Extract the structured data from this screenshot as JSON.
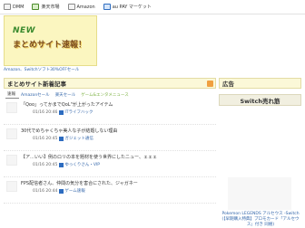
{
  "topbar": {
    "links": [
      {
        "label": "DMM",
        "icon": "page-icon"
      },
      {
        "label": "楽天市場",
        "icon": "rakuten-icon"
      },
      {
        "label": "Amazon",
        "icon": "page-icon"
      },
      {
        "label": "au PAY マーケット",
        "icon": "aupay-icon"
      }
    ]
  },
  "banner": {
    "new_label": "NEW",
    "title": "まとめサイト速報！"
  },
  "breadcrumb": "Amazon、Switchソフト30%OFFセール",
  "main": {
    "section_title": "まとめサイト新着記事",
    "tabs": [
      {
        "label": "速報"
      },
      {
        "label": "Amazonセール"
      },
      {
        "label": "楽天セール"
      },
      {
        "label": "ゲーム&エンタメニュース"
      }
    ],
    "articles": [
      {
        "title": "「Qoo」ってかまでQoL\"が上がったアイテム",
        "date": "01/16 20:46",
        "source": "ITライフハック"
      },
      {
        "title": "30代でめちゃくちゃ美人な子が結婚しない理由",
        "date": "01/16 20:45",
        "source": "ガジェット通信"
      },
      {
        "title": "【ア…いい】例のロリの本を題材を使う世界にしたニュー、ェェェ",
        "date": "01/16 20:45",
        "source": "ゆっくりさん・VIP"
      },
      {
        "title": "FPS配信者さん、仲間の気分を害合にされた、ジャガネー",
        "date": "01/16 20:44",
        "source": "ゲーム速報"
      }
    ]
  },
  "sidebar": {
    "ad_title": "広告",
    "switch_title": "Switch売れ筋",
    "product_name": "Pokemon LEGENDS アルセウス -Switch (【早期購入特典】プロモカード「アルセウス」付き 同梱)"
  }
}
